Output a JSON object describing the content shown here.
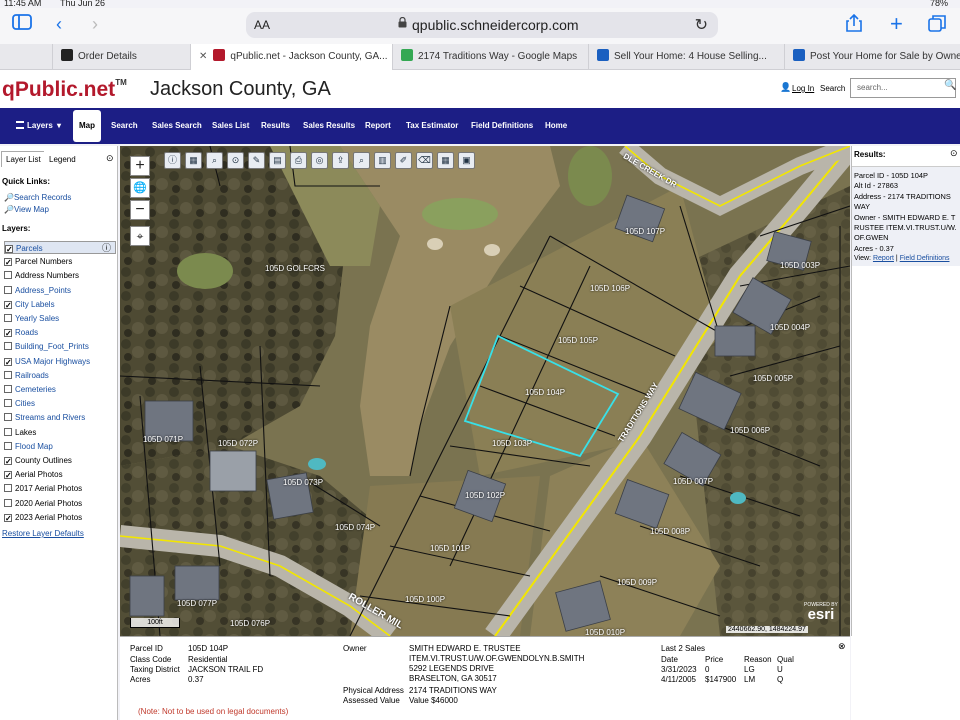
{
  "status_bar": {
    "time": "11:45 AM",
    "date": "Thu Jun 26",
    "battery": "78%"
  },
  "browser": {
    "aa_label": "AA",
    "url": "qpublic.schneidercorp.com",
    "tabs": [
      {
        "label": "Order Details",
        "color": "#222"
      },
      {
        "label": "qPublic.net - Jackson County, GA...",
        "color": "#b3192c"
      },
      {
        "label": "2174 Traditions Way - Google Maps",
        "color": "#34a853"
      },
      {
        "label": "Sell Your Home: 4 House Selling...",
        "color": "#1a5fc0"
      },
      {
        "label": "Post Your Home for Sale by Owne...",
        "color": "#1a5fc0"
      }
    ]
  },
  "header": {
    "logo": "qPublic.net",
    "tm": "TM",
    "county": "Jackson County, GA",
    "login": "Log In",
    "search_label": "Search",
    "search_placeholder": "search..."
  },
  "nav": {
    "items": [
      "Layers",
      "Map",
      "Search",
      "Sales Search",
      "Sales List",
      "Results",
      "Sales Results",
      "Report",
      "Tax Estimator",
      "Field Definitions",
      "Home"
    ],
    "active": "Map"
  },
  "left_panel": {
    "tabs": [
      "Layer List",
      "Legend"
    ],
    "quick_links_title": "Quick Links:",
    "quick_links": [
      "Search Records",
      "View Map"
    ],
    "layers_title": "Layers:",
    "layers": [
      {
        "label": "Parcels",
        "checked": true,
        "link": true
      },
      {
        "label": "Parcel Numbers",
        "checked": true,
        "link": false
      },
      {
        "label": "Address Numbers",
        "checked": false,
        "link": false
      },
      {
        "label": "Address_Points",
        "checked": false,
        "link": true
      },
      {
        "label": "City Labels",
        "checked": true,
        "link": true
      },
      {
        "label": "Yearly Sales",
        "checked": false,
        "link": true
      },
      {
        "label": "Roads",
        "checked": true,
        "link": true
      },
      {
        "label": "Building_Foot_Prints",
        "checked": false,
        "link": true
      },
      {
        "label": "USA Major Highways",
        "checked": true,
        "link": true
      },
      {
        "label": "Railroads",
        "checked": false,
        "link": true
      },
      {
        "label": "Cemeteries",
        "checked": false,
        "link": true
      },
      {
        "label": "Cities",
        "checked": false,
        "link": true
      },
      {
        "label": "Streams and Rivers",
        "checked": false,
        "link": true
      },
      {
        "label": "Lakes",
        "checked": false,
        "link": false
      },
      {
        "label": "Flood Map",
        "checked": false,
        "link": true
      },
      {
        "label": "County Outlines",
        "checked": true,
        "link": false
      },
      {
        "label": "Aerial Photos",
        "checked": true,
        "link": false
      },
      {
        "label": "2017 Aerial Photos",
        "checked": false,
        "link": false
      },
      {
        "label": "2020 Aerial Photos",
        "checked": false,
        "link": false
      },
      {
        "label": "2023 Aerial Photos",
        "checked": true,
        "link": false
      }
    ],
    "restore_defaults": "Restore Layer Defaults"
  },
  "map": {
    "scale": "100ft",
    "coords": "2440662.90, 1484224.97",
    "esri_powered": "POWERED BY",
    "esri": "esri",
    "road_labels": {
      "traditions": "TRADITIONS WAY",
      "creek": "DLE CREEK DR",
      "roller": "ROLLER MIL"
    },
    "parcel_labels": [
      "105D GOLFCRS",
      "105D 106P",
      "105D 105P",
      "105D 104P",
      "105D 103P",
      "105D 102P",
      "105D 101P",
      "105D 100P",
      "105D 074P",
      "105D 073P",
      "105D 072P",
      "105D 071P",
      "105D 077P",
      "105D 076P",
      "105D 107P",
      "105D 003P",
      "105D 004P",
      "105D 005P",
      "105D 006P",
      "105D 007P",
      "105D 008P",
      "105D 009P",
      "105D 010P"
    ]
  },
  "results": {
    "title": "Results:",
    "lines": [
      "Parcel ID - 105D 104P",
      "Alt Id - 27863",
      "Address - 2174 TRADITIONS WAY",
      "Owner - SMITH EDWARD E. TRUSTEE ITEM.VI.TRUST.U/W.OF.GWEN",
      "Acres - 0.37"
    ],
    "view_label": "View:",
    "report_link": "Report",
    "field_defs_link": "Field Definitions"
  },
  "details": {
    "parcel_id_label": "Parcel ID",
    "parcel_id": "105D 104P",
    "class_label": "Class Code",
    "class_code": "Residential",
    "district_label": "Taxing District",
    "district": "JACKSON TRAIL FD",
    "acres_label": "Acres",
    "acres": "0.37",
    "owner_label": "Owner",
    "owner_lines": [
      "SMITH EDWARD E. TRUSTEE",
      "ITEM.VI.TRUST.U/W.OF.GWENDOLYN.B.SMITH",
      "5292 LEGENDS DRIVE",
      "BRASELTON, GA 30517"
    ],
    "phys_label": "Physical Address",
    "phys_address": "2174 TRADITIONS WAY",
    "assessed_label": "Assessed Value",
    "assessed_value": "Value $46000",
    "note": "(Note: Not to be used on legal documents)",
    "sales_title": "Last 2 Sales",
    "sales_headers": [
      "Date",
      "Price",
      "Reason",
      "Qual"
    ],
    "sales": [
      [
        "3/31/2023",
        "0",
        "LG",
        "U"
      ],
      [
        "4/11/2005",
        "$147900",
        "LM",
        "Q"
      ]
    ]
  }
}
